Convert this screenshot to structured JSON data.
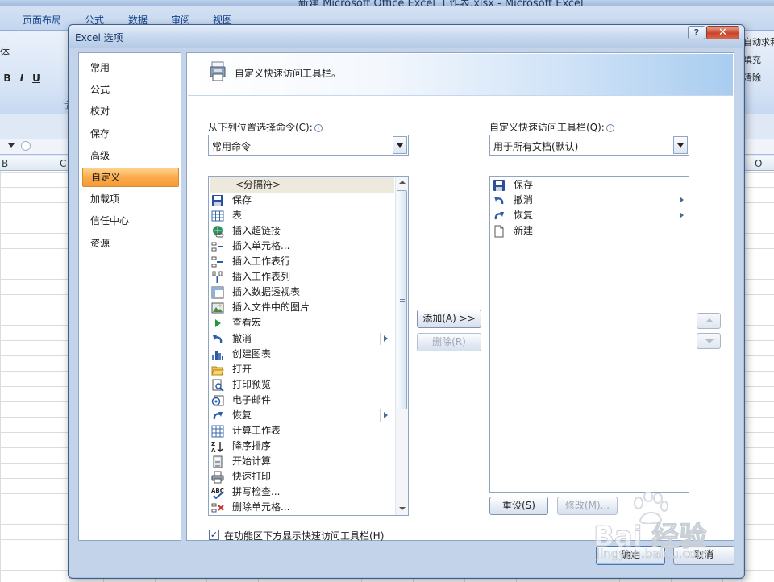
{
  "excel": {
    "window_title": "新建 Microsoft Office Excel 工作表.xlsx - Microsoft Excel",
    "tabs": [
      "页面布局",
      "公式",
      "数据",
      "审阅",
      "视图"
    ],
    "font_name": "体",
    "format_buttons": [
      "B",
      "I",
      "U"
    ],
    "ribbon_right": [
      "自动求和",
      "填充",
      "清除"
    ],
    "group_label": "字",
    "columns": [
      "B",
      "C",
      "O"
    ]
  },
  "dialog": {
    "title": "Excel 选项",
    "help_label": "?",
    "close_label": "✕",
    "nav": [
      {
        "label": "常用",
        "active": false
      },
      {
        "label": "公式",
        "active": false
      },
      {
        "label": "校对",
        "active": false
      },
      {
        "label": "保存",
        "active": false
      },
      {
        "label": "高级",
        "active": false
      },
      {
        "label": "自定义",
        "active": true
      },
      {
        "label": "加载项",
        "active": false
      },
      {
        "label": "信任中心",
        "active": false
      },
      {
        "label": "资源",
        "active": false
      }
    ],
    "header_title": "自定义快速访问工具栏。",
    "choose_from_label": "从下列位置选择命令(C):",
    "choose_from_value": "常用命令",
    "customize_label": "自定义快速访问工具栏(Q):",
    "customize_value": "用于所有文档(默认)",
    "commands": [
      {
        "label": "<分隔符>",
        "icon": "separator-icon",
        "submenu": false,
        "separator": true
      },
      {
        "label": "保存",
        "icon": "save-icon",
        "submenu": false
      },
      {
        "label": "表",
        "icon": "table-icon",
        "submenu": false
      },
      {
        "label": "插入超链接",
        "icon": "hyperlink-icon",
        "submenu": false
      },
      {
        "label": "插入单元格...",
        "icon": "insert-cells-icon",
        "submenu": false
      },
      {
        "label": "插入工作表行",
        "icon": "insert-row-icon",
        "submenu": false
      },
      {
        "label": "插入工作表列",
        "icon": "insert-column-icon",
        "submenu": false
      },
      {
        "label": "插入数据透视表",
        "icon": "pivot-table-icon",
        "submenu": false
      },
      {
        "label": "插入文件中的图片",
        "icon": "picture-icon",
        "submenu": false
      },
      {
        "label": "查看宏",
        "icon": "macro-icon",
        "submenu": false
      },
      {
        "label": "撤消",
        "icon": "undo-icon",
        "submenu": true
      },
      {
        "label": "创建图表",
        "icon": "chart-icon",
        "submenu": false
      },
      {
        "label": "打开",
        "icon": "open-folder-icon",
        "submenu": false
      },
      {
        "label": "打印预览",
        "icon": "print-preview-icon",
        "submenu": false
      },
      {
        "label": "电子邮件",
        "icon": "email-icon",
        "submenu": false
      },
      {
        "label": "恢复",
        "icon": "redo-icon",
        "submenu": true
      },
      {
        "label": "计算工作表",
        "icon": "calculate-sheet-icon",
        "submenu": false
      },
      {
        "label": "降序排序",
        "icon": "sort-descending-icon",
        "submenu": false
      },
      {
        "label": "开始计算",
        "icon": "calculate-icon",
        "submenu": false
      },
      {
        "label": "快速打印",
        "icon": "quick-print-icon",
        "submenu": false
      },
      {
        "label": "拼写检查...",
        "icon": "spelling-icon",
        "submenu": false
      },
      {
        "label": "删除单元格...",
        "icon": "delete-cells-icon",
        "submenu": false
      }
    ],
    "toolbar_items": [
      {
        "label": "保存",
        "icon": "save-icon",
        "submenu": false
      },
      {
        "label": "撤消",
        "icon": "undo-icon",
        "submenu": true
      },
      {
        "label": "恢复",
        "icon": "redo-icon",
        "submenu": true
      },
      {
        "label": "新建",
        "icon": "new-document-icon",
        "submenu": false
      }
    ],
    "add_button": "添加(A) >>",
    "remove_button": "删除(R)",
    "reset_button": "重设(S)",
    "modify_button": "修改(M)...",
    "show_below_ribbon_label": "在功能区下方显示快速访问工具栏(H)",
    "show_below_ribbon_checked": true,
    "ok_button": "确定",
    "cancel_button": "取消"
  },
  "watermark": {
    "brand": "Bai 经验",
    "url": "jingyan.baidu.com"
  },
  "colors": {
    "nav_active": "#fbab4b",
    "accent_blue": "#15428b",
    "close_red": "#c9432a"
  }
}
